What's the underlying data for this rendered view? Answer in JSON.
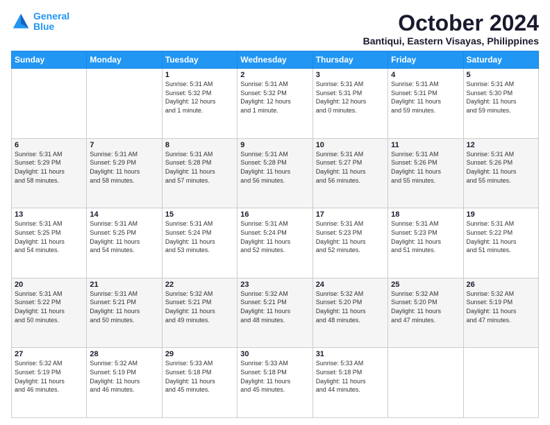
{
  "logo": {
    "line1": "General",
    "line2": "Blue"
  },
  "title": "October 2024",
  "subtitle": "Bantiqui, Eastern Visayas, Philippines",
  "days_of_week": [
    "Sunday",
    "Monday",
    "Tuesday",
    "Wednesday",
    "Thursday",
    "Friday",
    "Saturday"
  ],
  "weeks": [
    [
      {
        "day": "",
        "info": ""
      },
      {
        "day": "",
        "info": ""
      },
      {
        "day": "1",
        "info": "Sunrise: 5:31 AM\nSunset: 5:32 PM\nDaylight: 12 hours\nand 1 minute."
      },
      {
        "day": "2",
        "info": "Sunrise: 5:31 AM\nSunset: 5:32 PM\nDaylight: 12 hours\nand 1 minute."
      },
      {
        "day": "3",
        "info": "Sunrise: 5:31 AM\nSunset: 5:31 PM\nDaylight: 12 hours\nand 0 minutes."
      },
      {
        "day": "4",
        "info": "Sunrise: 5:31 AM\nSunset: 5:31 PM\nDaylight: 11 hours\nand 59 minutes."
      },
      {
        "day": "5",
        "info": "Sunrise: 5:31 AM\nSunset: 5:30 PM\nDaylight: 11 hours\nand 59 minutes."
      }
    ],
    [
      {
        "day": "6",
        "info": "Sunrise: 5:31 AM\nSunset: 5:29 PM\nDaylight: 11 hours\nand 58 minutes."
      },
      {
        "day": "7",
        "info": "Sunrise: 5:31 AM\nSunset: 5:29 PM\nDaylight: 11 hours\nand 58 minutes."
      },
      {
        "day": "8",
        "info": "Sunrise: 5:31 AM\nSunset: 5:28 PM\nDaylight: 11 hours\nand 57 minutes."
      },
      {
        "day": "9",
        "info": "Sunrise: 5:31 AM\nSunset: 5:28 PM\nDaylight: 11 hours\nand 56 minutes."
      },
      {
        "day": "10",
        "info": "Sunrise: 5:31 AM\nSunset: 5:27 PM\nDaylight: 11 hours\nand 56 minutes."
      },
      {
        "day": "11",
        "info": "Sunrise: 5:31 AM\nSunset: 5:26 PM\nDaylight: 11 hours\nand 55 minutes."
      },
      {
        "day": "12",
        "info": "Sunrise: 5:31 AM\nSunset: 5:26 PM\nDaylight: 11 hours\nand 55 minutes."
      }
    ],
    [
      {
        "day": "13",
        "info": "Sunrise: 5:31 AM\nSunset: 5:25 PM\nDaylight: 11 hours\nand 54 minutes."
      },
      {
        "day": "14",
        "info": "Sunrise: 5:31 AM\nSunset: 5:25 PM\nDaylight: 11 hours\nand 54 minutes."
      },
      {
        "day": "15",
        "info": "Sunrise: 5:31 AM\nSunset: 5:24 PM\nDaylight: 11 hours\nand 53 minutes."
      },
      {
        "day": "16",
        "info": "Sunrise: 5:31 AM\nSunset: 5:24 PM\nDaylight: 11 hours\nand 52 minutes."
      },
      {
        "day": "17",
        "info": "Sunrise: 5:31 AM\nSunset: 5:23 PM\nDaylight: 11 hours\nand 52 minutes."
      },
      {
        "day": "18",
        "info": "Sunrise: 5:31 AM\nSunset: 5:23 PM\nDaylight: 11 hours\nand 51 minutes."
      },
      {
        "day": "19",
        "info": "Sunrise: 5:31 AM\nSunset: 5:22 PM\nDaylight: 11 hours\nand 51 minutes."
      }
    ],
    [
      {
        "day": "20",
        "info": "Sunrise: 5:31 AM\nSunset: 5:22 PM\nDaylight: 11 hours\nand 50 minutes."
      },
      {
        "day": "21",
        "info": "Sunrise: 5:31 AM\nSunset: 5:21 PM\nDaylight: 11 hours\nand 50 minutes."
      },
      {
        "day": "22",
        "info": "Sunrise: 5:32 AM\nSunset: 5:21 PM\nDaylight: 11 hours\nand 49 minutes."
      },
      {
        "day": "23",
        "info": "Sunrise: 5:32 AM\nSunset: 5:21 PM\nDaylight: 11 hours\nand 48 minutes."
      },
      {
        "day": "24",
        "info": "Sunrise: 5:32 AM\nSunset: 5:20 PM\nDaylight: 11 hours\nand 48 minutes."
      },
      {
        "day": "25",
        "info": "Sunrise: 5:32 AM\nSunset: 5:20 PM\nDaylight: 11 hours\nand 47 minutes."
      },
      {
        "day": "26",
        "info": "Sunrise: 5:32 AM\nSunset: 5:19 PM\nDaylight: 11 hours\nand 47 minutes."
      }
    ],
    [
      {
        "day": "27",
        "info": "Sunrise: 5:32 AM\nSunset: 5:19 PM\nDaylight: 11 hours\nand 46 minutes."
      },
      {
        "day": "28",
        "info": "Sunrise: 5:32 AM\nSunset: 5:19 PM\nDaylight: 11 hours\nand 46 minutes."
      },
      {
        "day": "29",
        "info": "Sunrise: 5:33 AM\nSunset: 5:18 PM\nDaylight: 11 hours\nand 45 minutes."
      },
      {
        "day": "30",
        "info": "Sunrise: 5:33 AM\nSunset: 5:18 PM\nDaylight: 11 hours\nand 45 minutes."
      },
      {
        "day": "31",
        "info": "Sunrise: 5:33 AM\nSunset: 5:18 PM\nDaylight: 11 hours\nand 44 minutes."
      },
      {
        "day": "",
        "info": ""
      },
      {
        "day": "",
        "info": ""
      }
    ]
  ]
}
